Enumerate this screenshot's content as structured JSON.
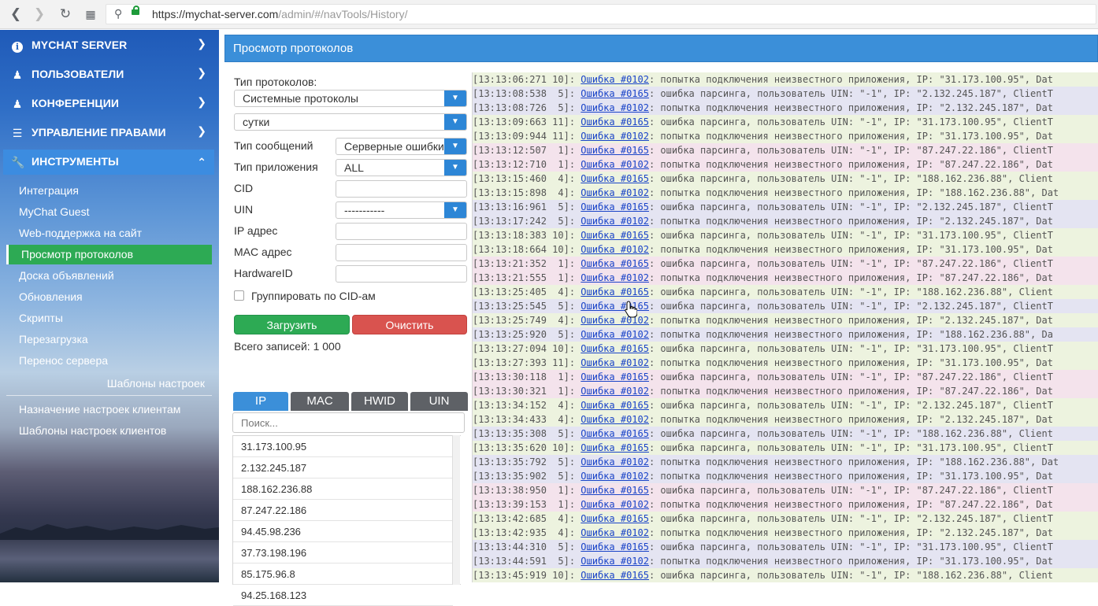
{
  "browser": {
    "url_host": "https://mychat-server.com",
    "url_path": "/admin/#/navTools/History/"
  },
  "sidebar": {
    "sections": [
      {
        "label": "MYCHAT SERVER",
        "icon": "info-icon"
      },
      {
        "label": "ПОЛЬЗОВАТЕЛИ",
        "icon": "users-icon"
      },
      {
        "label": "КОНФЕРЕНЦИИ",
        "icon": "conference-icon"
      },
      {
        "label": "УПРАВЛЕНИЕ ПРАВАМИ",
        "icon": "list-icon"
      },
      {
        "label": "ИНСТРУМЕНТЫ",
        "icon": "wrench-icon"
      }
    ],
    "tools_items": [
      "Интеграция",
      "MyChat Guest",
      "Web-поддержка на сайт",
      "Просмотр протоколов",
      "Доска объявлений",
      "Обновления",
      "Скрипты",
      "Перезагрузка",
      "Перенос сервера"
    ],
    "templates_header": "Шаблоны настроек",
    "templates_items": [
      "Назначение настроек клиентам",
      "Шаблоны настроек клиентов"
    ]
  },
  "panel": {
    "title": "Просмотр протоколов"
  },
  "filters": {
    "protocol_type_label": "Тип протоколов:",
    "protocol_type_value": "Системные протоколы",
    "period_value": "сутки",
    "message_type_label": "Тип сообщений",
    "message_type_value": "Серверные ошибки",
    "app_type_label": "Тип приложения",
    "app_type_value": "ALL",
    "cid_label": "CID",
    "uin_label": "UIN",
    "uin_value": "-----------",
    "ip_label": "IP адрес",
    "mac_label": "MAC адрес",
    "hwid_label": "HardwareID",
    "group_label": "Группировать по CID-ам",
    "load_button": "Загрузить",
    "clear_button": "Очистить",
    "total_records": "Всего записей: 1 000",
    "tabs": [
      "IP",
      "MAC",
      "HWID",
      "UIN"
    ],
    "search_placeholder": "Поиск...",
    "ip_list": [
      "31.173.100.95",
      "2.132.245.187",
      "188.162.236.88",
      "87.247.22.186",
      "94.45.98.236",
      "37.73.198.196",
      "85.175.96.8",
      "94.25.168.123"
    ]
  },
  "log": {
    "rows": [
      {
        "time": "[13:13:06:271 10]: ",
        "code": "Ошибка #0102",
        "msg": ": попытка подключения неизвестного приложения, IP: \"31.173.100.95\", Dat",
        "bg": "g"
      },
      {
        "time": "[13:13:08:538  5]: ",
        "code": "Ошибка #0165",
        "msg": ": ошибка парсинга, пользователь UIN: \"-1\", IP: \"2.132.245.187\", ClientT",
        "bg": "b"
      },
      {
        "time": "[13:13:08:726  5]: ",
        "code": "Ошибка #0102",
        "msg": ": попытка подключения неизвестного приложения, IP: \"2.132.245.187\", Dat",
        "bg": "b"
      },
      {
        "time": "[13:13:09:663 11]: ",
        "code": "Ошибка #0165",
        "msg": ": ошибка парсинга, пользователь UIN: \"-1\", IP: \"31.173.100.95\", ClientT",
        "bg": "g"
      },
      {
        "time": "[13:13:09:944 11]: ",
        "code": "Ошибка #0102",
        "msg": ": попытка подключения неизвестного приложения, IP: \"31.173.100.95\", Dat",
        "bg": "g"
      },
      {
        "time": "[13:13:12:507  1]: ",
        "code": "Ошибка #0165",
        "msg": ": ошибка парсинга, пользователь UIN: \"-1\", IP: \"87.247.22.186\", ClientT",
        "bg": "p"
      },
      {
        "time": "[13:13:12:710  1]: ",
        "code": "Ошибка #0102",
        "msg": ": попытка подключения неизвестного приложения, IP: \"87.247.22.186\", Dat",
        "bg": "p"
      },
      {
        "time": "[13:13:15:460  4]: ",
        "code": "Ошибка #0165",
        "msg": ": ошибка парсинга, пользователь UIN: \"-1\", IP: \"188.162.236.88\", Client",
        "bg": "g"
      },
      {
        "time": "[13:13:15:898  4]: ",
        "code": "Ошибка #0102",
        "msg": ": попытка подключения неизвестного приложения, IP: \"188.162.236.88\", Dat",
        "bg": "g"
      },
      {
        "time": "[13:13:16:961  5]: ",
        "code": "Ошибка #0165",
        "msg": ": ошибка парсинга, пользователь UIN: \"-1\", IP: \"2.132.245.187\", ClientT",
        "bg": "b"
      },
      {
        "time": "[13:13:17:242  5]: ",
        "code": "Ошибка #0102",
        "msg": ": попытка подключения неизвестного приложения, IP: \"2.132.245.187\", Dat",
        "bg": "b"
      },
      {
        "time": "[13:13:18:383 10]: ",
        "code": "Ошибка #0165",
        "msg": ": ошибка парсинга, пользователь UIN: \"-1\", IP: \"31.173.100.95\", ClientT",
        "bg": "g"
      },
      {
        "time": "[13:13:18:664 10]: ",
        "code": "Ошибка #0102",
        "msg": ": попытка подключения неизвестного приложения, IP: \"31.173.100.95\", Dat",
        "bg": "g"
      },
      {
        "time": "[13:13:21:352  1]: ",
        "code": "Ошибка #0165",
        "msg": ": ошибка парсинга, пользователь UIN: \"-1\", IP: \"87.247.22.186\", ClientT",
        "bg": "p"
      },
      {
        "time": "[13:13:21:555  1]: ",
        "code": "Ошибка #0102",
        "msg": ": попытка подключения неизвестного приложения, IP: \"87.247.22.186\", Dat",
        "bg": "p"
      },
      {
        "time": "[13:13:25:405  4]: ",
        "code": "Ошибка #0165",
        "msg": ": ошибка парсинга, пользователь UIN: \"-1\", IP: \"188.162.236.88\", Client",
        "bg": "g"
      },
      {
        "time": "[13:13:25:545  5]: ",
        "code": "Ошибка #0165",
        "msg": ": ошибка парсинга, пользователь UIN: \"-1\", IP: \"2.132.245.187\", ClientT",
        "bg": "b"
      },
      {
        "time": "[13:13:25:749  4]: ",
        "code": "Ошибка #0102",
        "msg": ": попытка подключения неизвестного приложения, IP: \"2.132.245.187\", Dat",
        "bg": "g"
      },
      {
        "time": "[13:13:25:920  5]: ",
        "code": "Ошибка #0102",
        "msg": ": попытка подключения неизвестного приложения, IP: \"188.162.236.88\", Da",
        "bg": "b"
      },
      {
        "time": "[13:13:27:094 10]: ",
        "code": "Ошибка #0165",
        "msg": ": ошибка парсинга, пользователь UIN: \"-1\", IP: \"31.173.100.95\", ClientT",
        "bg": "g"
      },
      {
        "time": "[13:13:27:393 11]: ",
        "code": "Ошибка #0102",
        "msg": ": попытка подключения неизвестного приложения, IP: \"31.173.100.95\", Dat",
        "bg": "g"
      },
      {
        "time": "[13:13:30:118  1]: ",
        "code": "Ошибка #0165",
        "msg": ": ошибка парсинга, пользователь UIN: \"-1\", IP: \"87.247.22.186\", ClientT",
        "bg": "p"
      },
      {
        "time": "[13:13:30:321  1]: ",
        "code": "Ошибка #0102",
        "msg": ": попытка подключения неизвестного приложения, IP: \"87.247.22.186\", Dat",
        "bg": "p"
      },
      {
        "time": "[13:13:34:152  4]: ",
        "code": "Ошибка #0165",
        "msg": ": ошибка парсинга, пользователь UIN: \"-1\", IP: \"2.132.245.187\", ClientT",
        "bg": "g"
      },
      {
        "time": "[13:13:34:433  4]: ",
        "code": "Ошибка #0102",
        "msg": ": попытка подключения неизвестного приложения, IP: \"2.132.245.187\", Dat",
        "bg": "g"
      },
      {
        "time": "[13:13:35:308  5]: ",
        "code": "Ошибка #0165",
        "msg": ": ошибка парсинга, пользователь UIN: \"-1\", IP: \"188.162.236.88\", Client",
        "bg": "b"
      },
      {
        "time": "[13:13:35:620 10]: ",
        "code": "Ошибка #0165",
        "msg": ": ошибка парсинга, пользователь UIN: \"-1\", IP: \"31.173.100.95\", ClientT",
        "bg": "g"
      },
      {
        "time": "[13:13:35:792  5]: ",
        "code": "Ошибка #0102",
        "msg": ": попытка подключения неизвестного приложения, IP: \"188.162.236.88\", Dat",
        "bg": "b"
      },
      {
        "time": "[13:13:35:902  5]: ",
        "code": "Ошибка #0102",
        "msg": ": попытка подключения неизвестного приложения, IP: \"31.173.100.95\", Dat",
        "bg": "b"
      },
      {
        "time": "[13:13:38:950  1]: ",
        "code": "Ошибка #0165",
        "msg": ": ошибка парсинга, пользователь UIN: \"-1\", IP: \"87.247.22.186\", ClientT",
        "bg": "p"
      },
      {
        "time": "[13:13:39:153  1]: ",
        "code": "Ошибка #0102",
        "msg": ": попытка подключения неизвестного приложения, IP: \"87.247.22.186\", Dat",
        "bg": "p"
      },
      {
        "time": "[13:13:42:685  4]: ",
        "code": "Ошибка #0165",
        "msg": ": ошибка парсинга, пользователь UIN: \"-1\", IP: \"2.132.245.187\", ClientT",
        "bg": "g"
      },
      {
        "time": "[13:13:42:935  4]: ",
        "code": "Ошибка #0102",
        "msg": ": попытка подключения неизвестного приложения, IP: \"2.132.245.187\", Dat",
        "bg": "g"
      },
      {
        "time": "[13:13:44:310  5]: ",
        "code": "Ошибка #0165",
        "msg": ": ошибка парсинга, пользователь UIN: \"-1\", IP: \"31.173.100.95\", ClientT",
        "bg": "b"
      },
      {
        "time": "[13:13:44:591  5]: ",
        "code": "Ошибка #0102",
        "msg": ": попытка подключения неизвестного приложения, IP: \"31.173.100.95\", Dat",
        "bg": "b"
      },
      {
        "time": "[13:13:45:919 10]: ",
        "code": "Ошибка #0165",
        "msg": ": ошибка парсинга, пользователь UIN: \"-1\", IP: \"188.162.236.88\", Client",
        "bg": "g"
      }
    ]
  }
}
